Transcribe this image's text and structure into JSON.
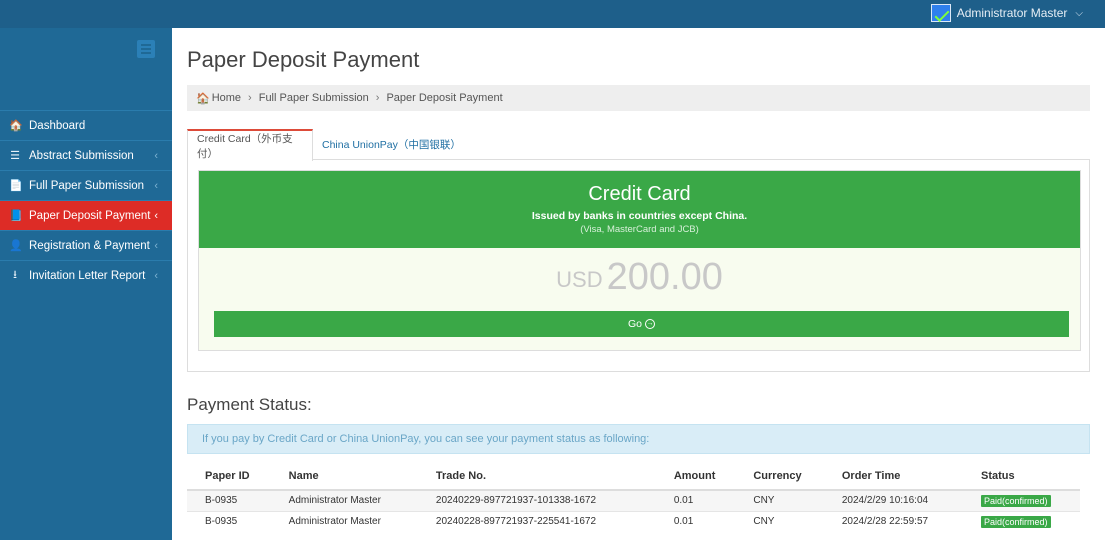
{
  "header": {
    "user_name": "Administrator Master",
    "user_chevron": "⌵"
  },
  "sidebar": {
    "items": [
      {
        "label": "Dashboard",
        "icon": "home-icon",
        "glyph": "🏠",
        "arrow": ""
      },
      {
        "label": "Abstract Submission",
        "icon": "list-icon",
        "glyph": "☰",
        "arrow": "‹"
      },
      {
        "label": "Full Paper Submission",
        "icon": "file-icon",
        "glyph": "📄",
        "arrow": "‹"
      },
      {
        "label": "Paper Deposit Payment",
        "icon": "book-icon",
        "glyph": "📘",
        "arrow": "‹",
        "active": true
      },
      {
        "label": "Registration & Payment",
        "icon": "user-icon",
        "glyph": "👤",
        "arrow": "‹"
      },
      {
        "label": "Invitation Letter Report",
        "icon": "download-icon",
        "glyph": "⭳",
        "arrow": "‹"
      }
    ]
  },
  "main": {
    "title": "Paper Deposit Payment",
    "breadcrumb": {
      "home": "Home",
      "level1": "Full Paper Submission",
      "level2": "Paper Deposit Payment",
      "separator": "›"
    },
    "tabs": [
      {
        "label": "Credit Card（外币支付）",
        "active": true
      },
      {
        "label": "China UnionPay（中国银联）",
        "active": false
      }
    ],
    "card": {
      "title": "Credit Card",
      "subtitle": "Issued by banks in countries except China.",
      "note": "(Visa, MasterCard and JCB)",
      "currency": "USD",
      "amount": "200.00",
      "go_label": "Go",
      "go_icon": "→"
    },
    "status": {
      "title": "Payment Status:",
      "info": "If you pay by Credit Card or China UnionPay, you can see your payment status as following:",
      "columns": [
        "Paper ID",
        "Name",
        "Trade No.",
        "Amount",
        "Currency",
        "Order Time",
        "Status"
      ],
      "rows": [
        [
          "B-0935",
          "Administrator Master",
          "20240229-897721937-101338-1672",
          "0.01",
          "CNY",
          "2024/2/29 10:16:04",
          "Paid(confirmed)"
        ],
        [
          "B-0935",
          "Administrator Master",
          "20240228-897721937-225541-1672",
          "0.01",
          "CNY",
          "2024/2/28 22:59:57",
          "Paid(confirmed)"
        ]
      ]
    }
  },
  "colors": {
    "sidebar": "#1f6996",
    "active": "#dd2c26",
    "green": "#3aa847",
    "info_bg": "#d9edf7"
  }
}
